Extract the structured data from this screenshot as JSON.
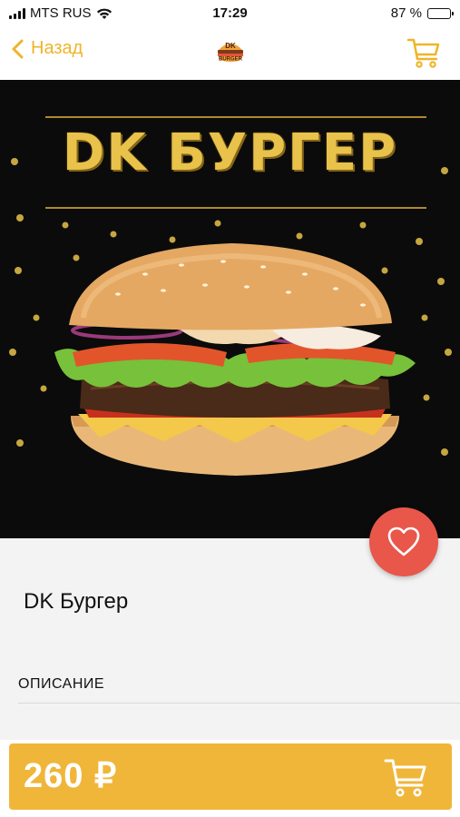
{
  "status_bar": {
    "carrier": "MTS RUS",
    "time": "17:29",
    "battery_percent": "87 %",
    "battery_level": 0.87
  },
  "nav": {
    "back_label": "Назад",
    "logo_text_top": "DK",
    "logo_text_bottom": "BURGER"
  },
  "hero": {
    "title": "DK БУРГЕР"
  },
  "product": {
    "name": "DK Бургер",
    "description_label": "ОПИСАНИЕ"
  },
  "buy": {
    "price": "260 ₽"
  },
  "colors": {
    "accent": "#f0b63a",
    "like": "#e8574a",
    "nav_accent": "#f0b429"
  }
}
